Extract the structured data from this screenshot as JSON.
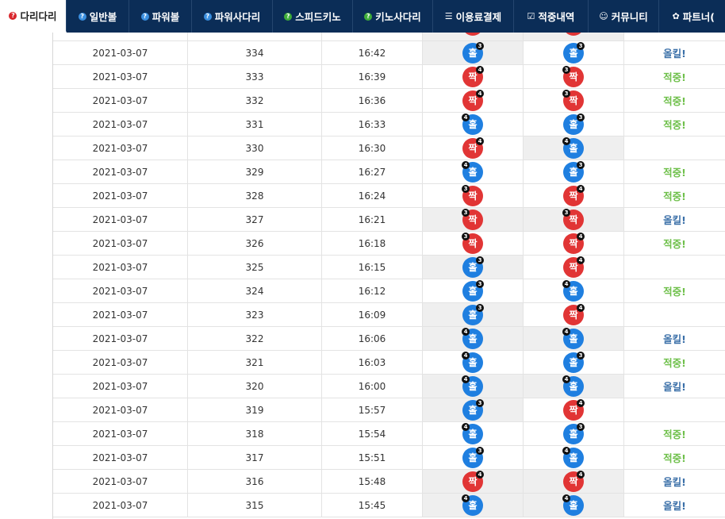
{
  "nav": [
    {
      "label": "다리다리",
      "icon": "?",
      "icon_name": "question-red-icon",
      "style": "ic-q-red",
      "active": true,
      "width": 84
    },
    {
      "label": "일반볼",
      "icon": "?",
      "icon_name": "question-blue-icon",
      "style": "ic-q-blue",
      "active": false,
      "width": 79
    },
    {
      "label": "파워볼",
      "icon": "?",
      "icon_name": "question-blue-icon",
      "style": "ic-q-blue",
      "active": false,
      "width": 79
    },
    {
      "label": "파워사다리",
      "icon": "?",
      "icon_name": "question-blue-icon",
      "style": "ic-q-blue",
      "active": false,
      "width": 102
    },
    {
      "label": "스피드키노",
      "icon": "?",
      "icon_name": "question-green-icon",
      "style": "ic-q-green",
      "active": false,
      "width": 101
    },
    {
      "label": "키노사다리",
      "icon": "?",
      "icon_name": "question-green-icon",
      "style": "ic-q-green",
      "active": false,
      "width": 101
    },
    {
      "label": "이용료결제",
      "icon": "☰",
      "icon_name": "database-icon",
      "style": "ic-plain",
      "active": false,
      "width": 102
    },
    {
      "label": "적중내역",
      "icon": "☑",
      "icon_name": "checkbox-icon",
      "style": "ic-plain",
      "active": false,
      "width": 94
    },
    {
      "label": "커뮤니티",
      "icon": "☺",
      "icon_name": "smiley-icon",
      "style": "ic-plain",
      "active": false,
      "width": 89
    },
    {
      "label": "파트너( ",
      "icon": "✿",
      "icon_name": "cubes-icon",
      "style": "ic-plain",
      "active": false,
      "width": 90
    }
  ],
  "table": {
    "top_partial": {
      "res1": {
        "type": "even",
        "label": "짝",
        "shaded": true
      },
      "res2": {
        "type": "even",
        "label": "짝",
        "shaded": true
      }
    },
    "rows": [
      {
        "date": "2021-03-07",
        "round": "334",
        "time": "16:42",
        "r1": {
          "label": "홀",
          "type": "odd",
          "badge": "3",
          "pos": "br",
          "shaded": true
        },
        "r2": {
          "label": "홀",
          "type": "odd",
          "badge": "3",
          "pos": "br",
          "shaded": false
        },
        "status": "올킬!",
        "status_type": "miss"
      },
      {
        "date": "2021-03-07",
        "round": "333",
        "time": "16:39",
        "r1": {
          "label": "짝",
          "type": "even",
          "badge": "4",
          "pos": "br",
          "shaded": false
        },
        "r2": {
          "label": "짝",
          "type": "even",
          "badge": "3",
          "pos": "bl",
          "shaded": false
        },
        "status": "적중!",
        "status_type": "hit"
      },
      {
        "date": "2021-03-07",
        "round": "332",
        "time": "16:36",
        "r1": {
          "label": "짝",
          "type": "even",
          "badge": "4",
          "pos": "br",
          "shaded": false
        },
        "r2": {
          "label": "짝",
          "type": "even",
          "badge": "3",
          "pos": "bl",
          "shaded": false
        },
        "status": "적중!",
        "status_type": "hit"
      },
      {
        "date": "2021-03-07",
        "round": "331",
        "time": "16:33",
        "r1": {
          "label": "홀",
          "type": "odd",
          "badge": "4",
          "pos": "bl",
          "shaded": false
        },
        "r2": {
          "label": "홀",
          "type": "odd",
          "badge": "3",
          "pos": "br",
          "shaded": false
        },
        "status": "적중!",
        "status_type": "hit"
      },
      {
        "date": "2021-03-07",
        "round": "330",
        "time": "16:30",
        "r1": {
          "label": "짝",
          "type": "even",
          "badge": "4",
          "pos": "br",
          "shaded": false
        },
        "r2": {
          "label": "홀",
          "type": "odd",
          "badge": "4",
          "pos": "bl",
          "shaded": true
        },
        "status": "",
        "status_type": "none"
      },
      {
        "date": "2021-03-07",
        "round": "329",
        "time": "16:27",
        "r1": {
          "label": "홀",
          "type": "odd",
          "badge": "4",
          "pos": "bl",
          "shaded": false
        },
        "r2": {
          "label": "홀",
          "type": "odd",
          "badge": "3",
          "pos": "br",
          "shaded": false
        },
        "status": "적중!",
        "status_type": "hit"
      },
      {
        "date": "2021-03-07",
        "round": "328",
        "time": "16:24",
        "r1": {
          "label": "짝",
          "type": "even",
          "badge": "3",
          "pos": "bl",
          "shaded": false
        },
        "r2": {
          "label": "짝",
          "type": "even",
          "badge": "4",
          "pos": "br",
          "shaded": false
        },
        "status": "적중!",
        "status_type": "hit"
      },
      {
        "date": "2021-03-07",
        "round": "327",
        "time": "16:21",
        "r1": {
          "label": "짝",
          "type": "even",
          "badge": "3",
          "pos": "bl",
          "shaded": true
        },
        "r2": {
          "label": "짝",
          "type": "even",
          "badge": "3",
          "pos": "bl",
          "shaded": true
        },
        "status": "올킬!",
        "status_type": "miss"
      },
      {
        "date": "2021-03-07",
        "round": "326",
        "time": "16:18",
        "r1": {
          "label": "짝",
          "type": "even",
          "badge": "3",
          "pos": "bl",
          "shaded": false
        },
        "r2": {
          "label": "짝",
          "type": "even",
          "badge": "4",
          "pos": "br",
          "shaded": false
        },
        "status": "적중!",
        "status_type": "hit"
      },
      {
        "date": "2021-03-07",
        "round": "325",
        "time": "16:15",
        "r1": {
          "label": "홀",
          "type": "odd",
          "badge": "3",
          "pos": "br",
          "shaded": true
        },
        "r2": {
          "label": "짝",
          "type": "even",
          "badge": "4",
          "pos": "br",
          "shaded": false
        },
        "status": "",
        "status_type": "none"
      },
      {
        "date": "2021-03-07",
        "round": "324",
        "time": "16:12",
        "r1": {
          "label": "홀",
          "type": "odd",
          "badge": "3",
          "pos": "br",
          "shaded": false
        },
        "r2": {
          "label": "홀",
          "type": "odd",
          "badge": "4",
          "pos": "bl",
          "shaded": false
        },
        "status": "적중!",
        "status_type": "hit"
      },
      {
        "date": "2021-03-07",
        "round": "323",
        "time": "16:09",
        "r1": {
          "label": "홀",
          "type": "odd",
          "badge": "3",
          "pos": "br",
          "shaded": true
        },
        "r2": {
          "label": "짝",
          "type": "even",
          "badge": "4",
          "pos": "br",
          "shaded": false
        },
        "status": "",
        "status_type": "none"
      },
      {
        "date": "2021-03-07",
        "round": "322",
        "time": "16:06",
        "r1": {
          "label": "홀",
          "type": "odd",
          "badge": "4",
          "pos": "bl",
          "shaded": true
        },
        "r2": {
          "label": "홀",
          "type": "odd",
          "badge": "4",
          "pos": "bl",
          "shaded": true
        },
        "status": "올킬!",
        "status_type": "miss"
      },
      {
        "date": "2021-03-07",
        "round": "321",
        "time": "16:03",
        "r1": {
          "label": "홀",
          "type": "odd",
          "badge": "4",
          "pos": "bl",
          "shaded": false
        },
        "r2": {
          "label": "홀",
          "type": "odd",
          "badge": "3",
          "pos": "br",
          "shaded": false
        },
        "status": "적중!",
        "status_type": "hit"
      },
      {
        "date": "2021-03-07",
        "round": "320",
        "time": "16:00",
        "r1": {
          "label": "홀",
          "type": "odd",
          "badge": "4",
          "pos": "bl",
          "shaded": true
        },
        "r2": {
          "label": "홀",
          "type": "odd",
          "badge": "4",
          "pos": "bl",
          "shaded": true
        },
        "status": "올킬!",
        "status_type": "miss"
      },
      {
        "date": "2021-03-07",
        "round": "319",
        "time": "15:57",
        "r1": {
          "label": "홀",
          "type": "odd",
          "badge": "3",
          "pos": "br",
          "shaded": true
        },
        "r2": {
          "label": "짝",
          "type": "even",
          "badge": "4",
          "pos": "br",
          "shaded": false
        },
        "status": "",
        "status_type": "none"
      },
      {
        "date": "2021-03-07",
        "round": "318",
        "time": "15:54",
        "r1": {
          "label": "홀",
          "type": "odd",
          "badge": "4",
          "pos": "bl",
          "shaded": false
        },
        "r2": {
          "label": "홀",
          "type": "odd",
          "badge": "3",
          "pos": "br",
          "shaded": false
        },
        "status": "적중!",
        "status_type": "hit"
      },
      {
        "date": "2021-03-07",
        "round": "317",
        "time": "15:51",
        "r1": {
          "label": "홀",
          "type": "odd",
          "badge": "3",
          "pos": "br",
          "shaded": false
        },
        "r2": {
          "label": "홀",
          "type": "odd",
          "badge": "4",
          "pos": "bl",
          "shaded": false
        },
        "status": "적중!",
        "status_type": "hit"
      },
      {
        "date": "2021-03-07",
        "round": "316",
        "time": "15:48",
        "r1": {
          "label": "짝",
          "type": "even",
          "badge": "4",
          "pos": "br",
          "shaded": true
        },
        "r2": {
          "label": "짝",
          "type": "even",
          "badge": "4",
          "pos": "br",
          "shaded": true
        },
        "status": "올킬!",
        "status_type": "miss"
      },
      {
        "date": "2021-03-07",
        "round": "315",
        "time": "15:45",
        "r1": {
          "label": "홀",
          "type": "odd",
          "badge": "4",
          "pos": "bl",
          "shaded": true
        },
        "r2": {
          "label": "홀",
          "type": "odd",
          "badge": "4",
          "pos": "bl",
          "shaded": true
        },
        "status": "올킬!",
        "status_type": "miss"
      }
    ]
  }
}
